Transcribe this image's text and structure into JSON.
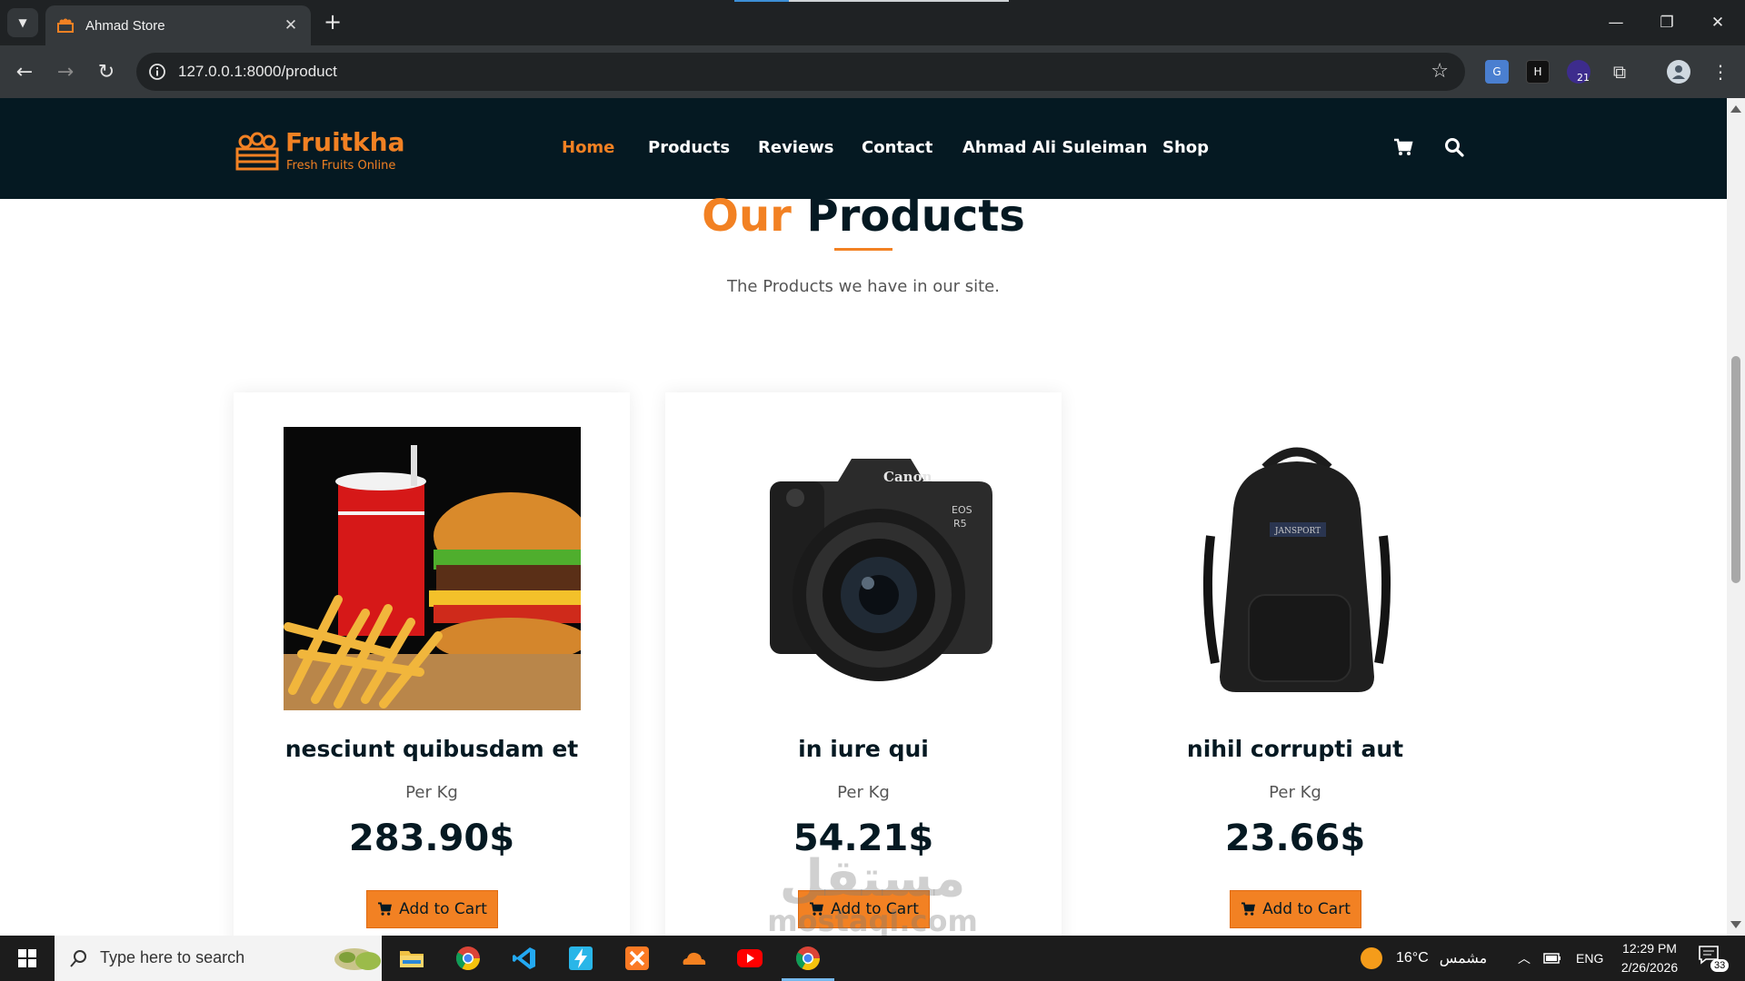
{
  "browser": {
    "tab_title": "Ahmad Store",
    "url": "127.0.0.1:8000/product",
    "extension_badge": "21"
  },
  "site": {
    "brand": "Fruitkha",
    "tagline": "Fresh Fruits Online",
    "nav": [
      "Home",
      "Products",
      "Reviews",
      "Contact",
      "Ahmad Ali Suleiman",
      "Shop"
    ],
    "active_nav": "Home",
    "accent_color": "#f28123",
    "header_bg": "#051922"
  },
  "section": {
    "title_highlight": "Our",
    "title_rest": "Products",
    "subtitle": "The Products we have in our site."
  },
  "products": [
    {
      "name": "nesciunt quibusdam et",
      "unit": "Per Kg",
      "price": "283.90$",
      "image": "burger-fries-soda-image",
      "button": "Add to Cart"
    },
    {
      "name": "in iure qui",
      "unit": "Per Kg",
      "price": "54.21$",
      "image": "canon-camera-image",
      "button": "Add to Cart"
    },
    {
      "name": "nihil corrupti aut",
      "unit": "Per Kg",
      "price": "23.66$",
      "image": "black-backpack-image",
      "button": "Add to Cart"
    }
  ],
  "watermark": {
    "line1": "مستقل",
    "line2": "mostaql.com"
  },
  "taskbar": {
    "search_placeholder": "Type here to search",
    "weather_temp": "16°C",
    "weather_text": "مشمس",
    "language": "ENG",
    "time": "12:29 PM",
    "date": "2/26/2026",
    "notification_count": "33"
  }
}
